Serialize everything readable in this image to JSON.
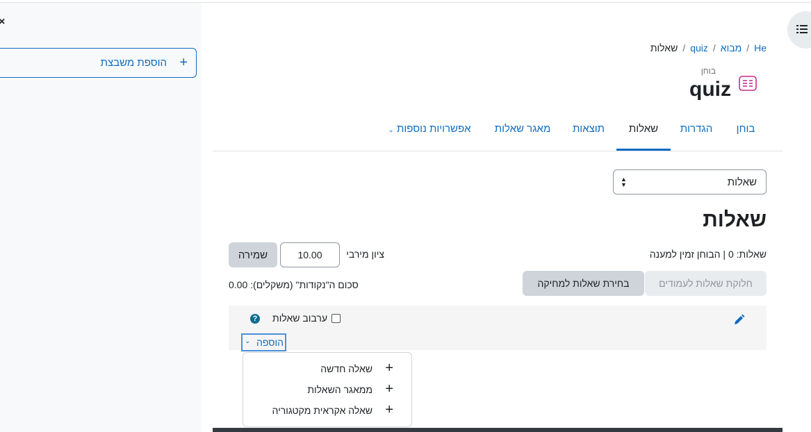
{
  "drawer": {
    "close_glyph": "×",
    "add_block_label": "הוספת משבצת",
    "add_block_icon": "plus-icon"
  },
  "index_button_icon": "list-icon",
  "breadcrumb": [
    {
      "label": "He"
    },
    {
      "label": "מבוא"
    },
    {
      "label": "quiz"
    },
    {
      "label": "שאלות"
    }
  ],
  "module": {
    "type_label": "בוחן",
    "title": "quiz",
    "icon": "quiz-icon",
    "icon_color": "#c82c8a"
  },
  "tabs": [
    {
      "label": "בוחן"
    },
    {
      "label": "הגדרות"
    },
    {
      "label": "שאלות",
      "active": true
    },
    {
      "label": "תוצאות"
    },
    {
      "label": "מאגר שאלות"
    },
    {
      "label": "אפשרויות נוספות"
    }
  ],
  "nav_select": {
    "value": "שאלות"
  },
  "heading": "שאלות",
  "info_line": "שאלות: 0 | הבוחן זמין למענה",
  "max_grade": {
    "label": "ציון מירבי",
    "value": "10.00",
    "save_label": "שמירה"
  },
  "buttons": {
    "repaginate": "חלוקת שאלות לעמודים",
    "select_multiple": "בחירת שאלות למחיקה"
  },
  "total_marks": "סכום ה\"נקודות\" (משקלים): 0.00",
  "section": {
    "shuffle_label": "ערבוב שאלות",
    "help": "?",
    "add_label": "הוספה"
  },
  "add_menu": [
    {
      "label": "שאלה חדשה"
    },
    {
      "label": "ממאגר השאלות"
    },
    {
      "label": "שאלה אקראית מקטגוריה"
    }
  ],
  "colors": {
    "link": "#0f6cbf",
    "accent": "#0f6cbf",
    "text": "#1d2125"
  }
}
